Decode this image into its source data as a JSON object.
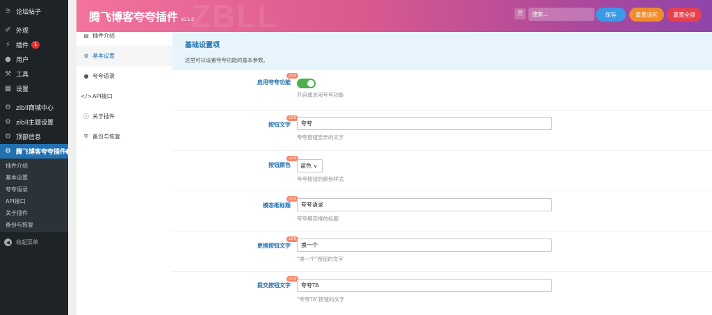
{
  "wp_menu": {
    "items": [
      {
        "label": "论坛帖子",
        "icon": "forum-icon"
      },
      {
        "label": "外观",
        "icon": "brush-icon"
      },
      {
        "label": "插件",
        "icon": "plug-icon",
        "badge": "1"
      },
      {
        "label": "用户",
        "icon": "user-icon"
      },
      {
        "label": "工具",
        "icon": "wrench-icon"
      },
      {
        "label": "设置",
        "icon": "settings-icon"
      },
      {
        "label": "zibll商城中心",
        "icon": "gear-icon"
      },
      {
        "label": "zibll主题设置",
        "icon": "gear-icon"
      },
      {
        "label": "顶部信息",
        "icon": "gear-icon"
      },
      {
        "label": "腾飞博客夸夸插件",
        "icon": "gear-icon"
      }
    ],
    "submenu": [
      "插件介绍",
      "基本设置",
      "夸夸语录",
      "API接口",
      "关于插件",
      "备份与恢复"
    ],
    "collapse": "收起菜单"
  },
  "header": {
    "title": "腾飞博客夸夸插件",
    "version": "v2.1.0",
    "watermark": "ZBLL",
    "search_placeholder": "搜索...",
    "save": "保存",
    "reset_section": "重置选区",
    "reset_all": "重置全部"
  },
  "nav": [
    {
      "label": "插件介绍",
      "icon": "book-icon"
    },
    {
      "label": "基本设置",
      "icon": "gears-icon"
    },
    {
      "label": "夸夸语录",
      "icon": "comment-icon"
    },
    {
      "label": "API接口",
      "icon": "code-icon"
    },
    {
      "label": "关于插件",
      "icon": "info-icon"
    },
    {
      "label": "备份与恢复",
      "icon": "shield-icon"
    }
  ],
  "section": {
    "title": "基础设置项",
    "desc": "这里可以设置夸夸功能的基本参数。"
  },
  "fields": {
    "enable": {
      "label": "启用夸夸功能",
      "ver": "v2.0",
      "help": "开启或关闭夸夸功能",
      "value": "on"
    },
    "btn_text": {
      "label": "按钮文字",
      "ver": "v2.0",
      "value": "夸夸",
      "help": "夸夸按钮显示的文字"
    },
    "btn_color": {
      "label": "按钮颜色",
      "ver": "v2.0",
      "value": "蓝色",
      "help": "夸夸按钮的颜色样式"
    },
    "modal_title": {
      "label": "模态框标题",
      "ver": "v2.0",
      "value": "夸夸语录",
      "help": "夸夸模态框的标题"
    },
    "change_text": {
      "label": "更换按钮文字",
      "ver": "v2.0",
      "value": "换一个",
      "help": "\"换一个\"按钮的文字"
    },
    "submit_text": {
      "label": "提交按钮文字",
      "ver": "v2.0",
      "value": "夸夸TA",
      "help": "\"夸夸TA\"按钮的文字"
    }
  }
}
